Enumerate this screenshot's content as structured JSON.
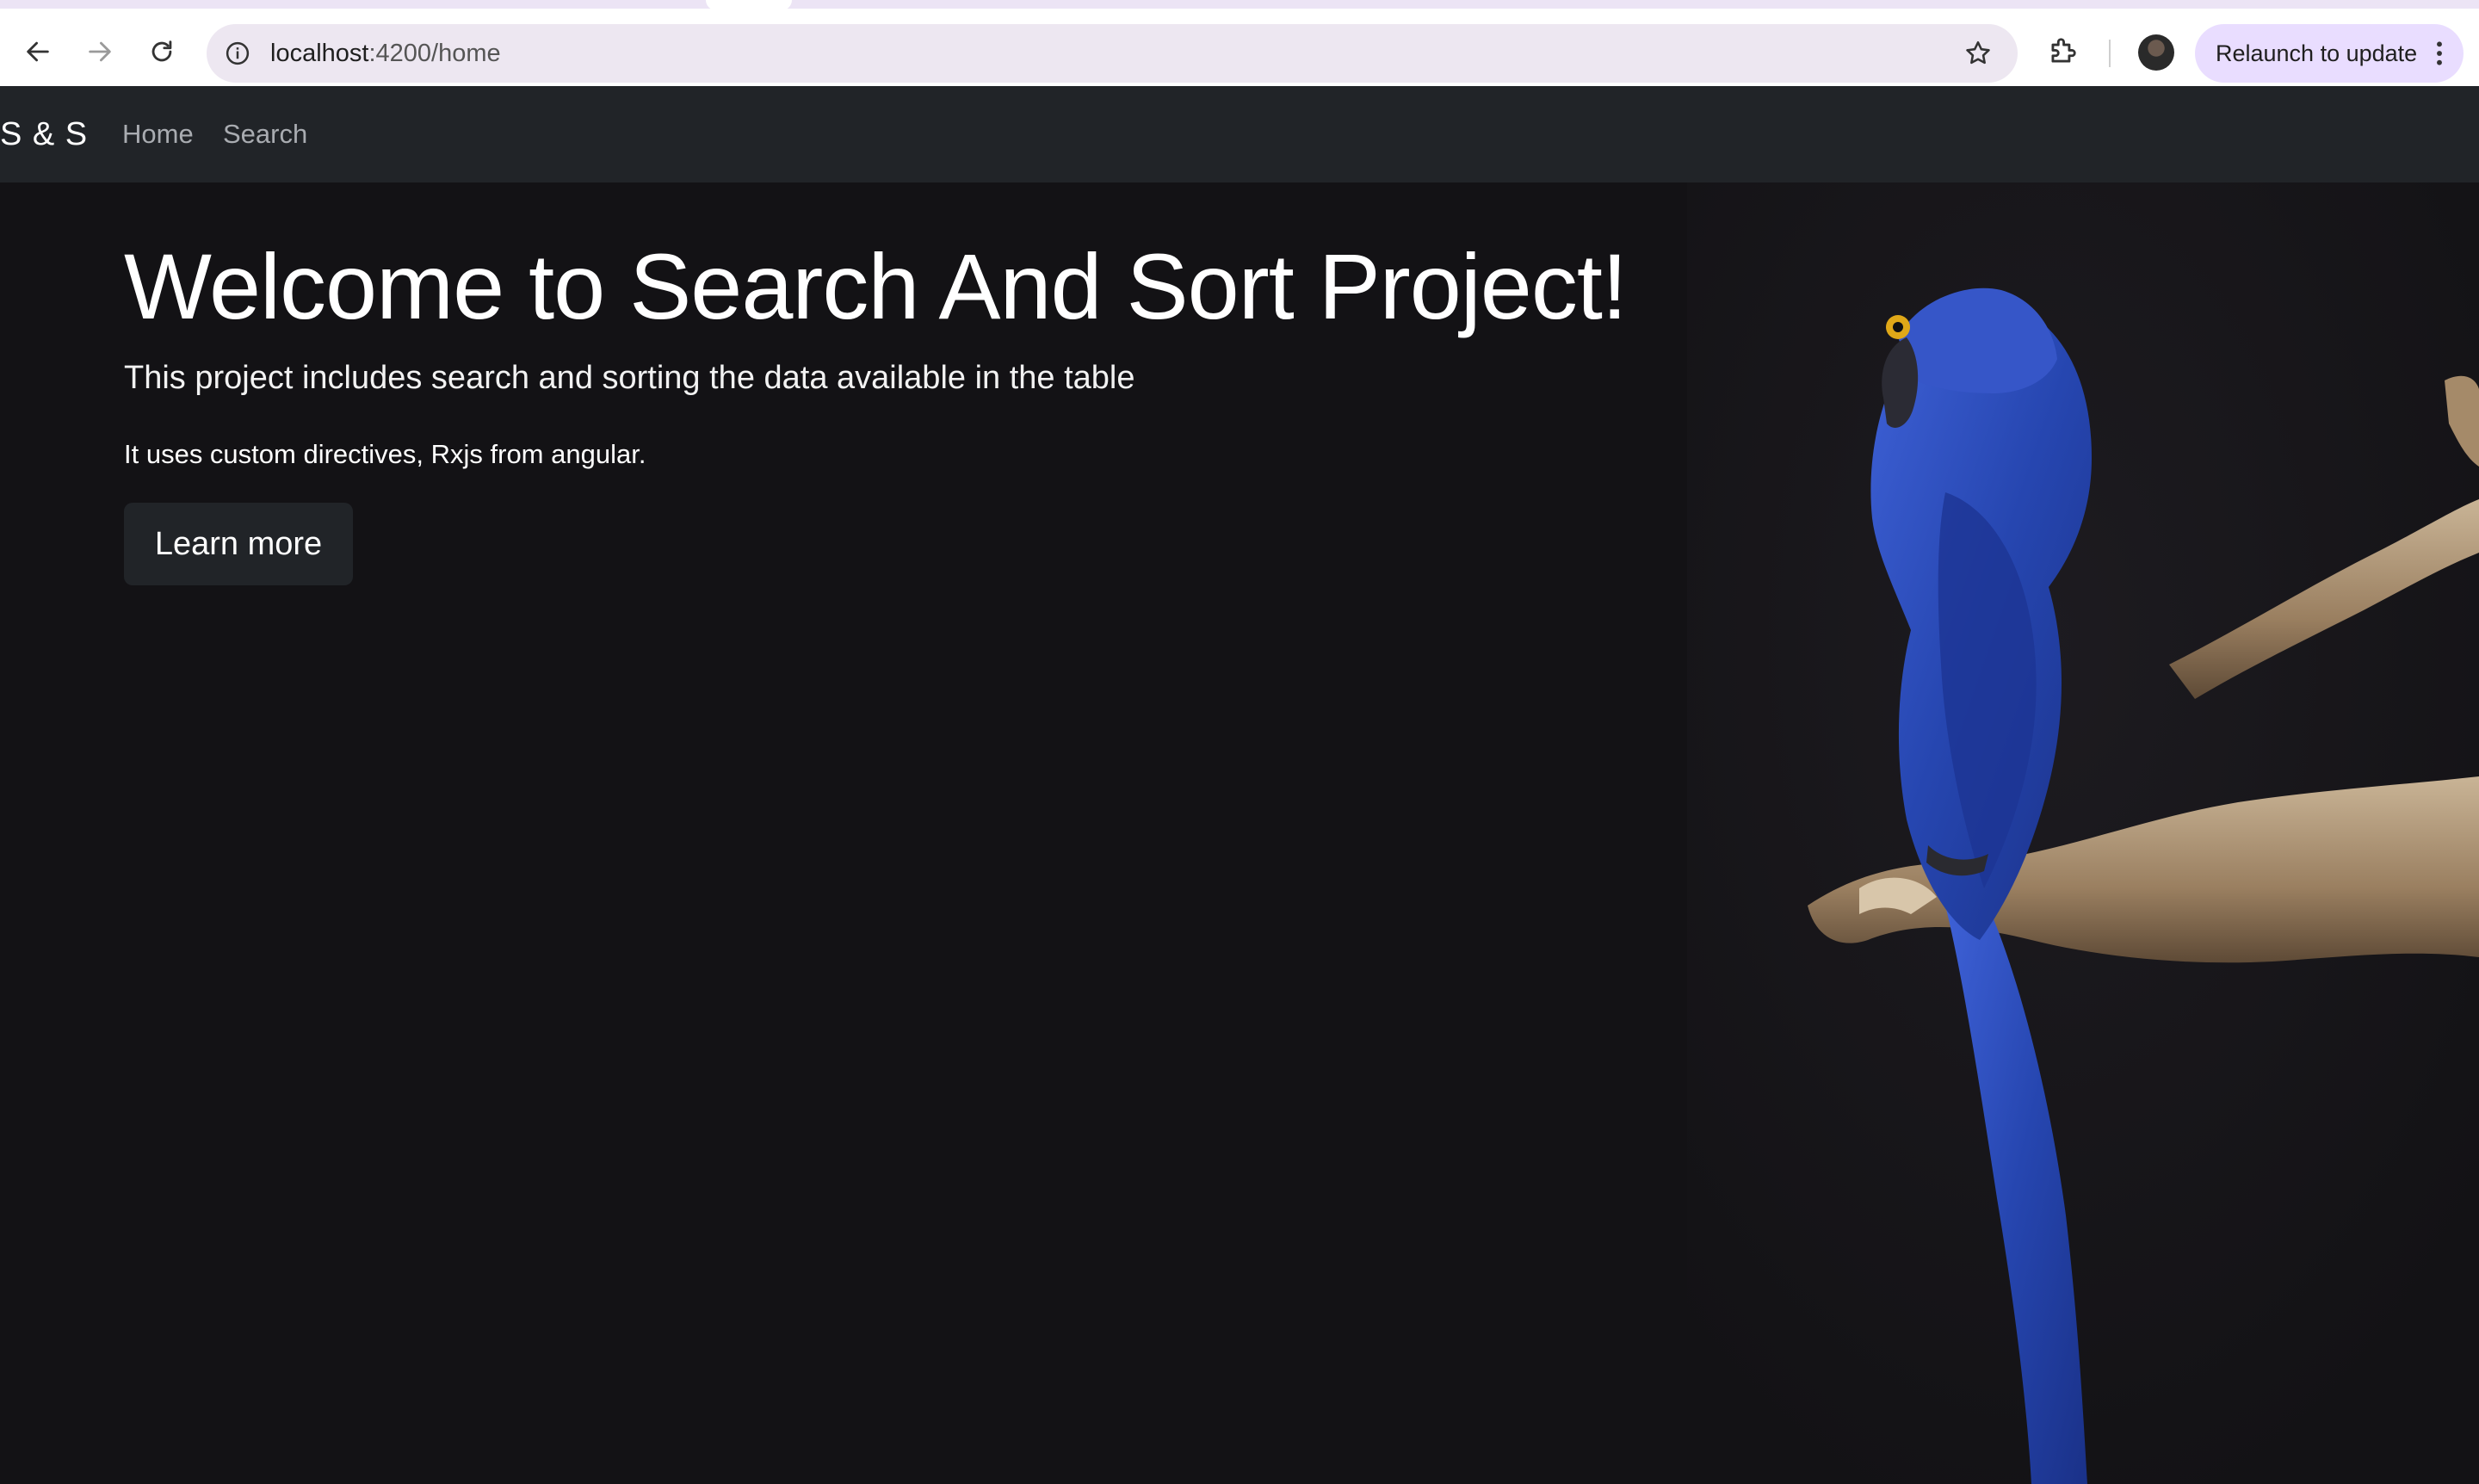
{
  "browser": {
    "url_host": "localhost",
    "url_path": ":4200/home",
    "relaunch_label": "Relaunch to update"
  },
  "navbar": {
    "brand": "S & S",
    "links": [
      {
        "label": "Home"
      },
      {
        "label": "Search"
      }
    ]
  },
  "hero": {
    "title": "Welcome to Search And Sort Project!",
    "lead": "This project includes search and sorting the data available in the table",
    "text": "It uses custom directives, Rxjs from angular.",
    "button_label": "Learn more"
  },
  "colors": {
    "navbar_bg": "#212428",
    "hero_bg": "#131215",
    "parrot": "#2a4bb8",
    "branch": "#b59a7a"
  },
  "icons": [
    "back-arrow-icon",
    "forward-arrow-icon",
    "reload-icon",
    "info-icon",
    "star-icon",
    "extensions-icon",
    "kebab-menu-icon"
  ]
}
